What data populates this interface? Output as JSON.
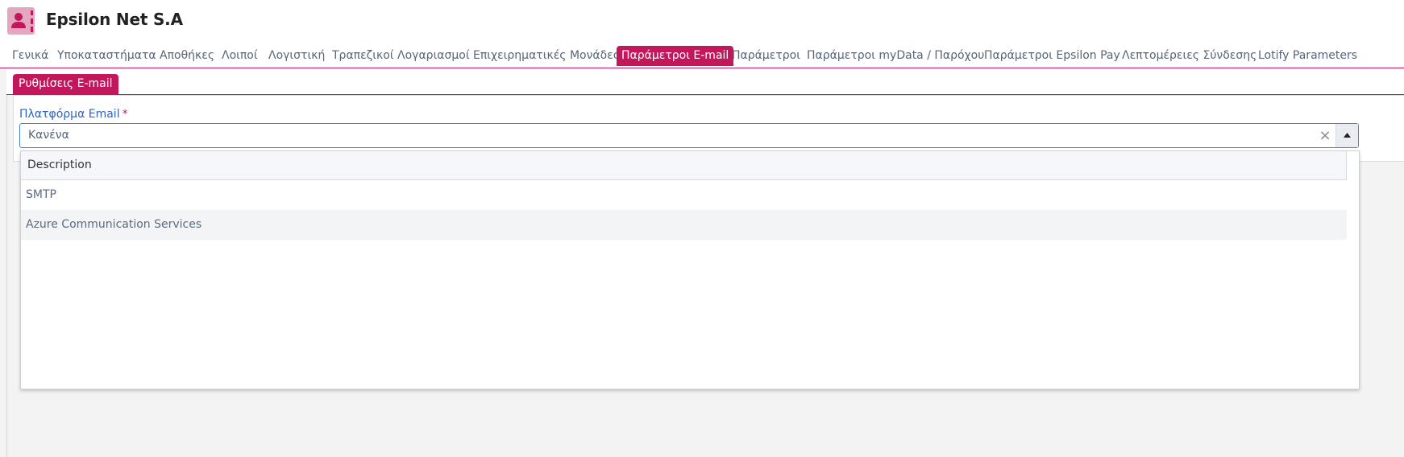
{
  "app": {
    "title": "Epsilon Net S.A",
    "icon": "user-icon",
    "accent_color": "#c2185b"
  },
  "tabs": [
    {
      "label": "Γενικά",
      "active": false
    },
    {
      "label": "Υποκαταστήματα",
      "active": false
    },
    {
      "label": "Αποθήκες",
      "active": false
    },
    {
      "label": "Λοιποί",
      "active": false
    },
    {
      "label": "Λογιστική",
      "active": false
    },
    {
      "label": "Τραπεζικοί Λογαριασμοί",
      "active": false
    },
    {
      "label": "Επιχειρηματικές Μονάδες",
      "active": false
    },
    {
      "label": "Παράμετροι E-mail",
      "active": true
    },
    {
      "label": "Παράμετροι",
      "active": false
    },
    {
      "label": "Παράμετροι myData / Παρόχου",
      "active": false
    },
    {
      "label": "Παράμετροι Epsilon Pay",
      "active": false
    },
    {
      "label": "Λεπτομέρειες Σύνδεσης",
      "active": false
    },
    {
      "label": "Lotify Parameters",
      "active": false
    }
  ],
  "subtab": {
    "label": "Ρυθμίσεις E-mail"
  },
  "email_platform": {
    "label": "Πλατφόρμα Email",
    "required_mark": "*",
    "value": "Κανένα",
    "clear_icon": "close-icon",
    "toggle_icon": "caret-up-icon"
  },
  "dropdown": {
    "column_header": "Description",
    "options": [
      "SMTP",
      "Azure Communication Services"
    ],
    "hovered_index": 1
  }
}
